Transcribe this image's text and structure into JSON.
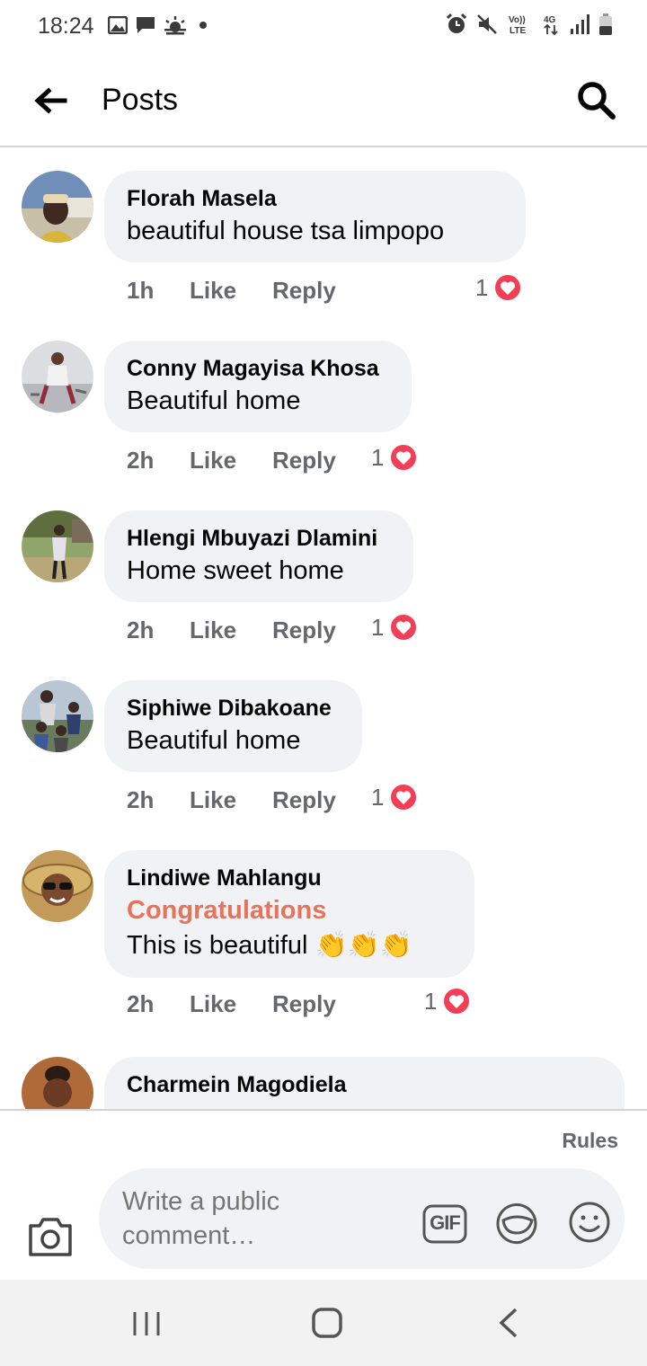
{
  "status_bar": {
    "time": "18:24",
    "left_icons": [
      "gallery-icon",
      "message-icon",
      "weather-icon",
      "dot-icon"
    ],
    "right_icons": [
      "alarm-icon",
      "mute-icon",
      "volte-icon",
      "4g-icon",
      "signal-icon",
      "battery-icon"
    ],
    "volte_label": "Vo)) LTE",
    "net_label": "4G"
  },
  "header": {
    "title": "Posts"
  },
  "comments": [
    {
      "author": "Florah Masela",
      "text": "beautiful  house tsa limpopo",
      "time": "1h",
      "like": "Like",
      "reply": "Reply",
      "reactions": "1"
    },
    {
      "author": "Conny Magayisa Khosa",
      "text": "Beautiful home",
      "time": "2h",
      "like": "Like",
      "reply": "Reply",
      "reactions": "1"
    },
    {
      "author": "Hlengi Mbuyazi Dlamini",
      "text": "Home sweet home",
      "time": "2h",
      "like": "Like",
      "reply": "Reply",
      "reactions": "1"
    },
    {
      "author": "Siphiwe Dibakoane",
      "text": "Beautiful home",
      "time": "2h",
      "like": "Like",
      "reply": "Reply",
      "reactions": "1"
    },
    {
      "author": "Lindiwe Mahlangu",
      "tag": "Congratulations",
      "text": "This is beautiful 👏👏👏",
      "time": "2h",
      "like": "Like",
      "reply": "Reply",
      "reactions": "1"
    },
    {
      "author": "Charmein Magodiela"
    }
  ],
  "composer": {
    "rules": "Rules",
    "placeholder": "Write a public comment…",
    "gif_label": "GIF"
  },
  "colors": {
    "accent_tag": "#e9735a",
    "heart": "#f33e58",
    "bubble": "#f0f2f5"
  }
}
